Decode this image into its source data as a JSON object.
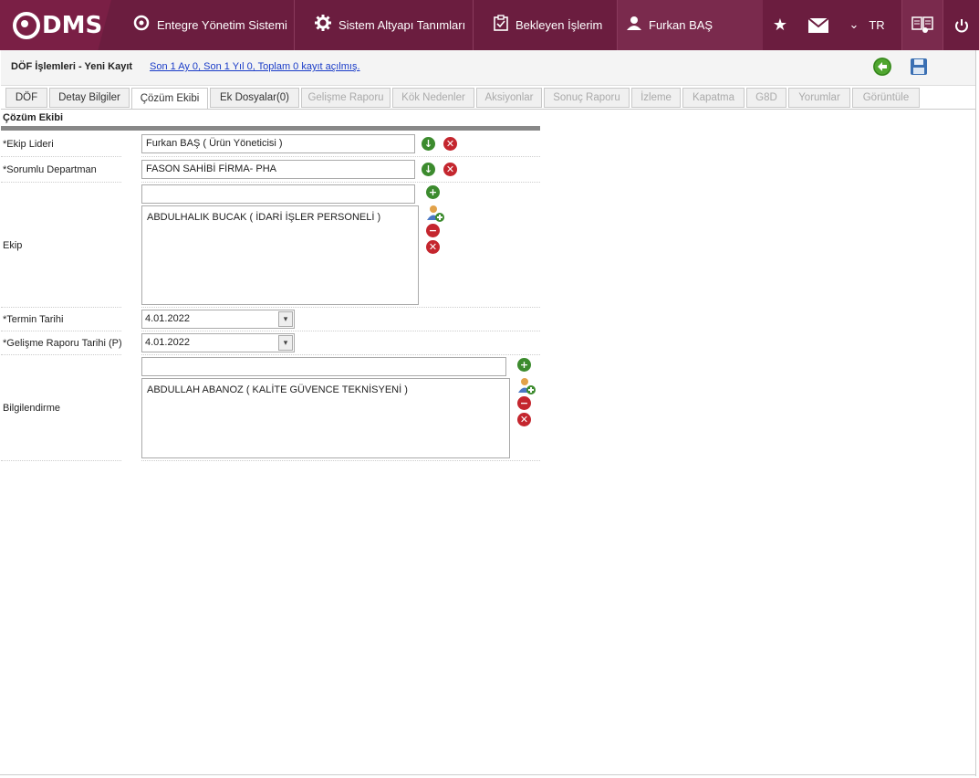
{
  "app": {
    "logo_text": "DMS",
    "nav": {
      "integrated": "Entegre Yönetim Sistemi",
      "system": "Sistem Altyapı Tanımları",
      "pending": "Bekleyen İşlerim",
      "user": "Furkan BAŞ"
    },
    "lang": "TR"
  },
  "page": {
    "title": "DÖF İşlemleri - Yeni Kayıt",
    "stats_link": "Son 1 Ay 0, Son 1 Yıl 0, Toplam 0 kayıt açılmış."
  },
  "tabs": [
    {
      "label": "DÖF",
      "state": "normal"
    },
    {
      "label": "Detay Bilgiler",
      "state": "normal"
    },
    {
      "label": "Çözüm Ekibi",
      "state": "active"
    },
    {
      "label": "Ek Dosyalar(0)",
      "state": "normal"
    },
    {
      "label": "Gelişme Raporu",
      "state": "disabled"
    },
    {
      "label": "Kök Nedenler",
      "state": "disabled"
    },
    {
      "label": "Aksiyonlar",
      "state": "disabled"
    },
    {
      "label": "Sonuç Raporu",
      "state": "disabled"
    },
    {
      "label": "İzleme",
      "state": "disabled"
    },
    {
      "label": "Kapatma",
      "state": "disabled"
    },
    {
      "label": "G8D",
      "state": "disabled"
    },
    {
      "label": "Yorumlar",
      "state": "disabled"
    },
    {
      "label": "Görüntüle",
      "state": "disabled"
    }
  ],
  "form": {
    "section_title": "Çözüm Ekibi",
    "team_leader_label": "*Ekip Lideri",
    "team_leader_value": "Furkan BAŞ ( Ürün Yöneticisi )",
    "department_label": "*Sorumlu Departman",
    "department_value": "FASON SAHİBİ FİRMA- PHA",
    "team_label": "Ekip",
    "team_input": "",
    "team_members": [
      "ABDULHALIK BUCAK ( İDARİ İŞLER PERSONELİ )"
    ],
    "due_date_label": "*Termin Tarihi",
    "due_date_value": "4.01.2022",
    "progress_date_label": "*Gelişme Raporu Tarihi (P)",
    "progress_date_value": "4.01.2022",
    "inform_label": "Bilgilendirme",
    "inform_input": "",
    "inform_members": [
      "ABDULLAH ABANOZ ( KALİTE GÜVENCE TEKNİSYENİ )"
    ]
  },
  "colors": {
    "topbar": "#6b1d3f",
    "green": "#3c8b2e",
    "red": "#c4262e",
    "link": "#1a3cc8"
  }
}
